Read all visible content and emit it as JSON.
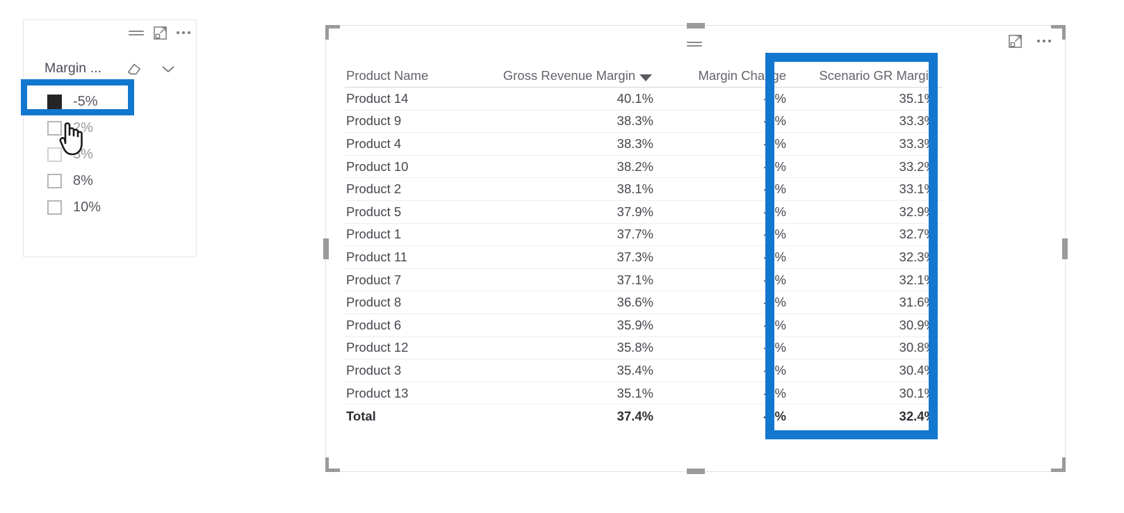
{
  "slicer": {
    "title": "Margin ...",
    "header_icons": [
      "filter-icon",
      "focus-mode-icon",
      "more-options-icon"
    ],
    "clear_icon": "eraser-icon",
    "expand_icon": "chevron-down-icon",
    "items": [
      {
        "label": "-5%",
        "checked": true,
        "faded": false,
        "highlighted": true
      },
      {
        "label": "2%",
        "checked": false,
        "faded": true,
        "highlighted": false
      },
      {
        "label": "5%",
        "checked": false,
        "faded": true,
        "highlighted": false
      },
      {
        "label": "8%",
        "checked": false,
        "faded": false,
        "highlighted": false
      },
      {
        "label": "10%",
        "checked": false,
        "faded": false,
        "highlighted": false
      }
    ]
  },
  "table": {
    "header_icons": [
      "focus-mode-icon",
      "more-options-icon"
    ],
    "filter_icon": "filter-icon",
    "sort_indicator": "sort-descending-arrow",
    "sorted_column": "Gross Revenue Margin",
    "columns": [
      "Product Name",
      "Gross Revenue Margin",
      "Margin Change",
      "Scenario GR Margin"
    ],
    "rows": [
      {
        "name": "Product 14",
        "gross_revenue_margin": "40.1%",
        "margin_change": "-5%",
        "scenario_gr_margin": "35.1%"
      },
      {
        "name": "Product 9",
        "gross_revenue_margin": "38.3%",
        "margin_change": "-5%",
        "scenario_gr_margin": "33.3%"
      },
      {
        "name": "Product 4",
        "gross_revenue_margin": "38.3%",
        "margin_change": "-5%",
        "scenario_gr_margin": "33.3%"
      },
      {
        "name": "Product 10",
        "gross_revenue_margin": "38.2%",
        "margin_change": "-5%",
        "scenario_gr_margin": "33.2%"
      },
      {
        "name": "Product 2",
        "gross_revenue_margin": "38.1%",
        "margin_change": "-5%",
        "scenario_gr_margin": "33.1%"
      },
      {
        "name": "Product 5",
        "gross_revenue_margin": "37.9%",
        "margin_change": "-5%",
        "scenario_gr_margin": "32.9%"
      },
      {
        "name": "Product 1",
        "gross_revenue_margin": "37.7%",
        "margin_change": "-5%",
        "scenario_gr_margin": "32.7%"
      },
      {
        "name": "Product 11",
        "gross_revenue_margin": "37.3%",
        "margin_change": "-5%",
        "scenario_gr_margin": "32.3%"
      },
      {
        "name": "Product 7",
        "gross_revenue_margin": "37.1%",
        "margin_change": "-5%",
        "scenario_gr_margin": "32.1%"
      },
      {
        "name": "Product 8",
        "gross_revenue_margin": "36.6%",
        "margin_change": "-5%",
        "scenario_gr_margin": "31.6%"
      },
      {
        "name": "Product 6",
        "gross_revenue_margin": "35.9%",
        "margin_change": "-5%",
        "scenario_gr_margin": "30.9%"
      },
      {
        "name": "Product 12",
        "gross_revenue_margin": "35.8%",
        "margin_change": "-5%",
        "scenario_gr_margin": "30.8%"
      },
      {
        "name": "Product 3",
        "gross_revenue_margin": "35.4%",
        "margin_change": "-5%",
        "scenario_gr_margin": "30.4%"
      },
      {
        "name": "Product 13",
        "gross_revenue_margin": "35.1%",
        "margin_change": "-5%",
        "scenario_gr_margin": "30.1%"
      }
    ],
    "total": {
      "name": "Total",
      "gross_revenue_margin": "37.4%",
      "margin_change": "-5%",
      "scenario_gr_margin": "32.4%"
    }
  },
  "annotations": {
    "color": "#1277CE",
    "targets": [
      "slicer-item--5pct",
      "table-column-scenario-gr-margin"
    ]
  },
  "cursor": {
    "type": "pointing-hand-cursor"
  }
}
